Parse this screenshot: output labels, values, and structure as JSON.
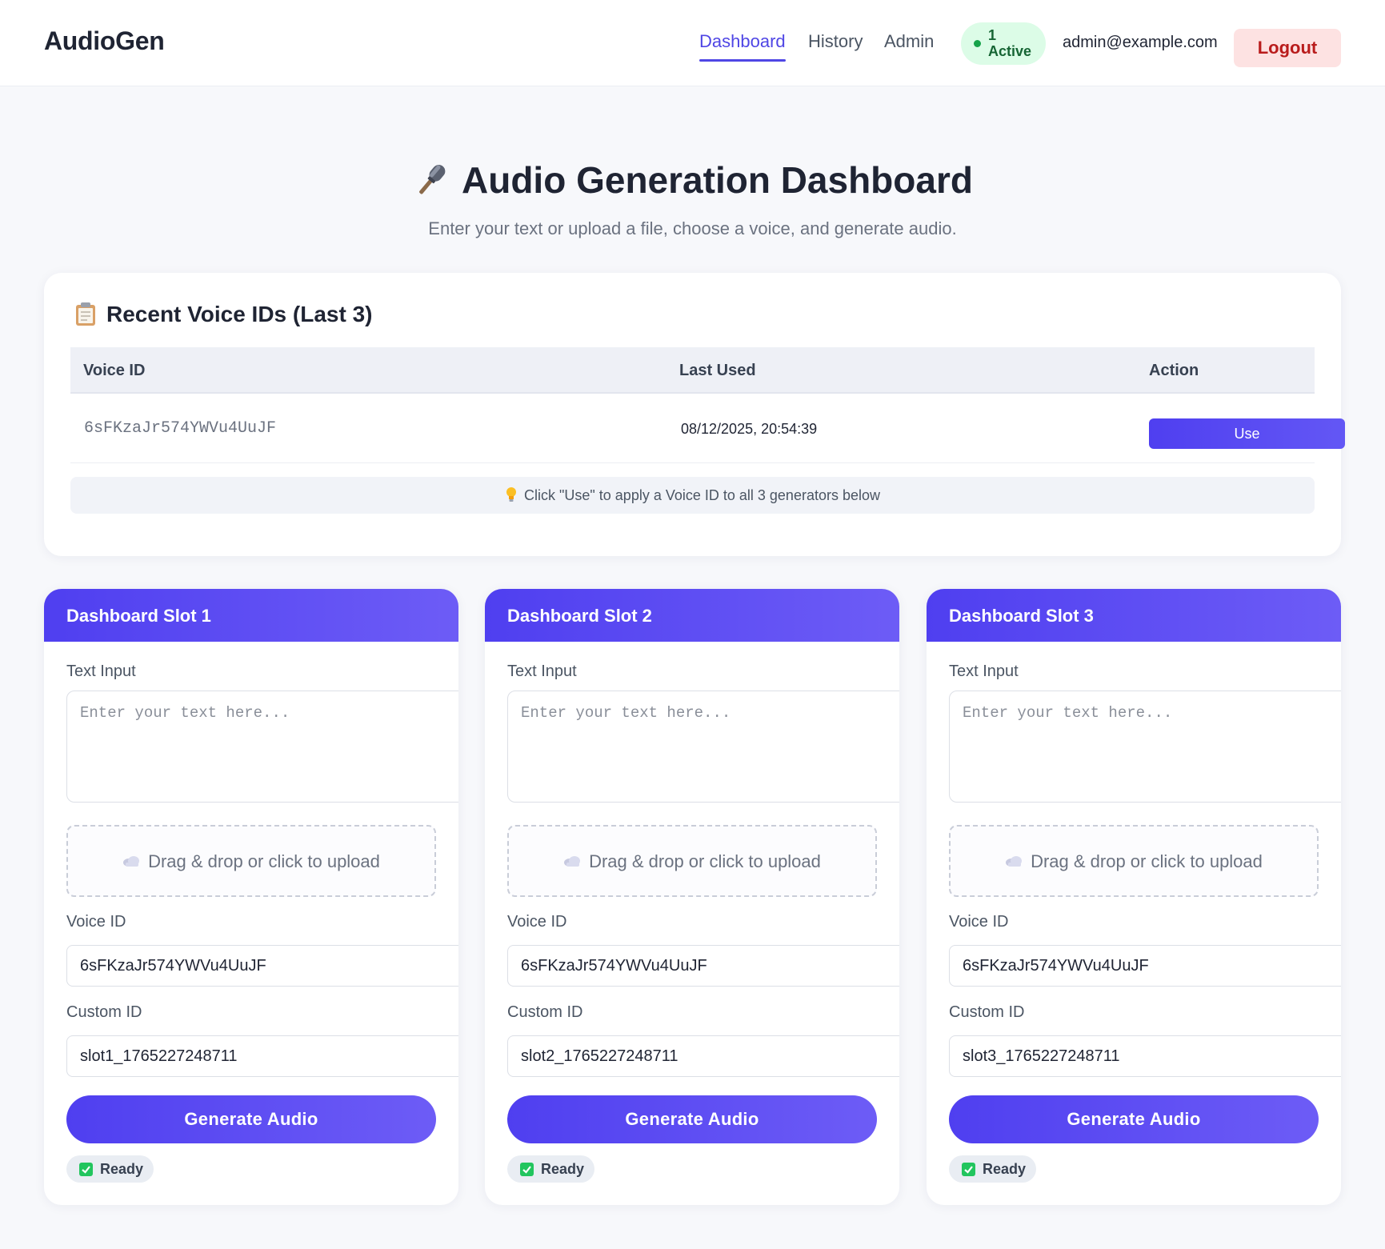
{
  "header": {
    "brand": "AudioGen",
    "nav": [
      {
        "label": "Dashboard",
        "active": true
      },
      {
        "label": "History",
        "active": false
      },
      {
        "label": "Admin",
        "active": false
      }
    ],
    "active_count": "1",
    "active_label": "Active",
    "user_email": "admin@example.com",
    "logout_label": "Logout"
  },
  "hero": {
    "title": "Audio Generation Dashboard",
    "subtitle": "Enter your text or upload a file, choose a voice, and generate audio."
  },
  "recent": {
    "title": "Recent Voice IDs (Last 3)",
    "columns": [
      "Voice ID",
      "Last Used",
      "Action"
    ],
    "rows": [
      {
        "voice_id": "6sFKzaJr574YWVu4UuJF",
        "last_used": "08/12/2025, 20:54:39",
        "action": "Use"
      }
    ],
    "hint": "Click \"Use\" to apply a Voice ID to all 3 generators below"
  },
  "slots": [
    {
      "title": "Dashboard Slot 1",
      "text_label": "Text Input",
      "text_placeholder": "Enter your text here...",
      "upload_label": "Drag & drop or click to upload",
      "voice_label": "Voice ID",
      "voice_value": "6sFKzaJr574YWVu4UuJF",
      "custom_label": "Custom ID",
      "custom_value": "slot1_1765227248711",
      "button_label": "Generate Audio",
      "status": "Ready"
    },
    {
      "title": "Dashboard Slot 2",
      "text_label": "Text Input",
      "text_placeholder": "Enter your text here...",
      "upload_label": "Drag & drop or click to upload",
      "voice_label": "Voice ID",
      "voice_value": "6sFKzaJr574YWVu4UuJF",
      "custom_label": "Custom ID",
      "custom_value": "slot2_1765227248711",
      "button_label": "Generate Audio",
      "status": "Ready"
    },
    {
      "title": "Dashboard Slot 3",
      "text_label": "Text Input",
      "text_placeholder": "Enter your text here...",
      "upload_label": "Drag & drop or click to upload",
      "voice_label": "Voice ID",
      "voice_value": "6sFKzaJr574YWVu4UuJF",
      "custom_label": "Custom ID",
      "custom_value": "slot3_1765227248711",
      "button_label": "Generate Audio",
      "status": "Ready"
    }
  ],
  "icons": {
    "hero": "microphone-icon",
    "recent": "clipboard-icon",
    "hint": "lightbulb-icon",
    "upload": "cloud-icon",
    "status": "check-icon",
    "active": "status-dot-icon"
  },
  "colors": {
    "accent": "#4f46e5",
    "gradient_start": "#4f3ff0",
    "gradient_end": "#6d5cf6",
    "active_bg": "#dcfce7",
    "active_text": "#166534",
    "logout_bg": "#fde2e2",
    "logout_text": "#b91c1c"
  }
}
